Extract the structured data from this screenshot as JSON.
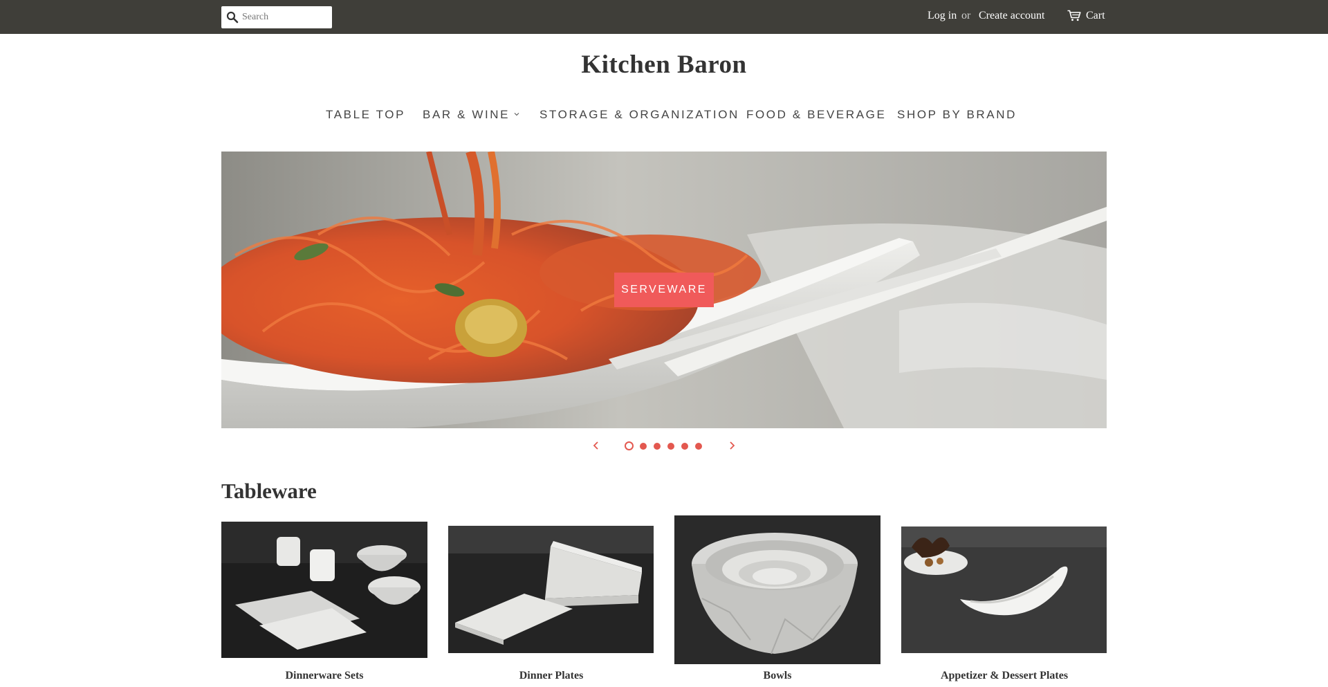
{
  "header": {
    "search_placeholder": "Search",
    "login_label": "Log in",
    "or_label": "or",
    "create_account_label": "Create account",
    "cart_label": "Cart"
  },
  "logo": "Kitchen Baron",
  "nav": [
    {
      "label": "TABLE TOP"
    },
    {
      "label": "BAR & WINE"
    },
    {
      "label": "STORAGE & ORGANIZATION"
    },
    {
      "label": "FOOD & BEVERAGE"
    },
    {
      "label": "SHOP BY BRAND"
    }
  ],
  "hero": {
    "button_label": "SERVEWARE",
    "slide_count": 6,
    "active_slide": 1
  },
  "section": {
    "title": "Tableware",
    "items": [
      {
        "label": "Dinnerware Sets"
      },
      {
        "label": "Dinner Plates"
      },
      {
        "label": "Bowls"
      },
      {
        "label": "Appetizer & Dessert Plates"
      }
    ]
  },
  "colors": {
    "topbar": "#3f3e39",
    "accent": "#f05a5a",
    "text": "#333333"
  }
}
